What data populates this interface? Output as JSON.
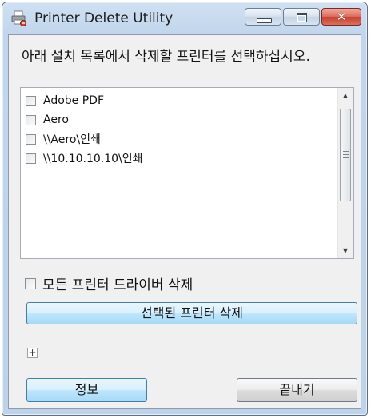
{
  "window": {
    "title": "Printer Delete Utility",
    "close_glyph": "✕"
  },
  "instruction": "아래 설치 목록에서 삭제할 프린터를 선택하십시오.",
  "printer_list": {
    "items": [
      {
        "label": "Adobe PDF",
        "checked": false
      },
      {
        "label": "Aero",
        "checked": false
      },
      {
        "label": "\\\\Aero\\인쇄",
        "checked": false
      },
      {
        "label": "\\\\10.10.10.10\\인쇄",
        "checked": false
      }
    ],
    "scroll_up_glyph": "▲",
    "scroll_down_glyph": "▼"
  },
  "all_drivers_label": "모든 프린터 드라이버 삭제",
  "delete_button_label": "선택된 프린터 삭제",
  "expander_glyph": "+",
  "info_button_label": "정보",
  "exit_button_label": "끝내기",
  "colors": {
    "titlebar": "#c1d6ec",
    "close_button": "#c7402d",
    "focus_button": "#bee6fd"
  }
}
